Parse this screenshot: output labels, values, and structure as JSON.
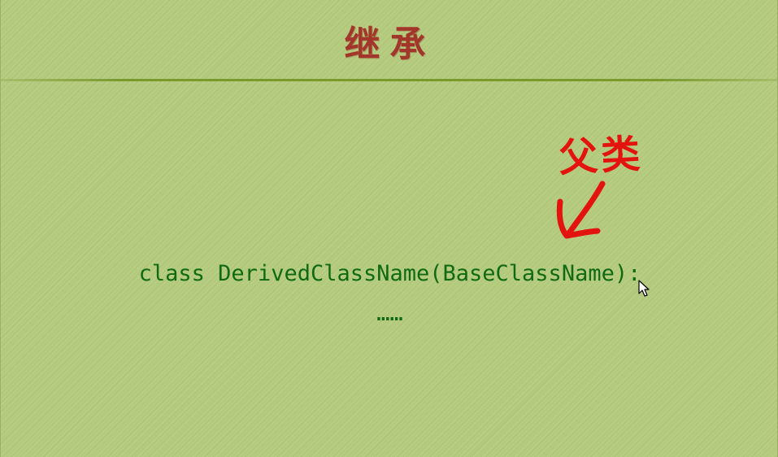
{
  "slide": {
    "title": "继承",
    "annotation": {
      "label": "父类",
      "arrow_icon": "hand-drawn-arrow-icon"
    },
    "code": {
      "line1": "class DerivedClassName(BaseClassName):",
      "line2": "……"
    },
    "cursor_icon": "mouse-pointer-icon"
  },
  "colors": {
    "background": "#b3ca7c",
    "title": "#a3362a",
    "annotation": "#e3140f",
    "code": "#0f6a12",
    "divider": "#7a9a2e"
  }
}
